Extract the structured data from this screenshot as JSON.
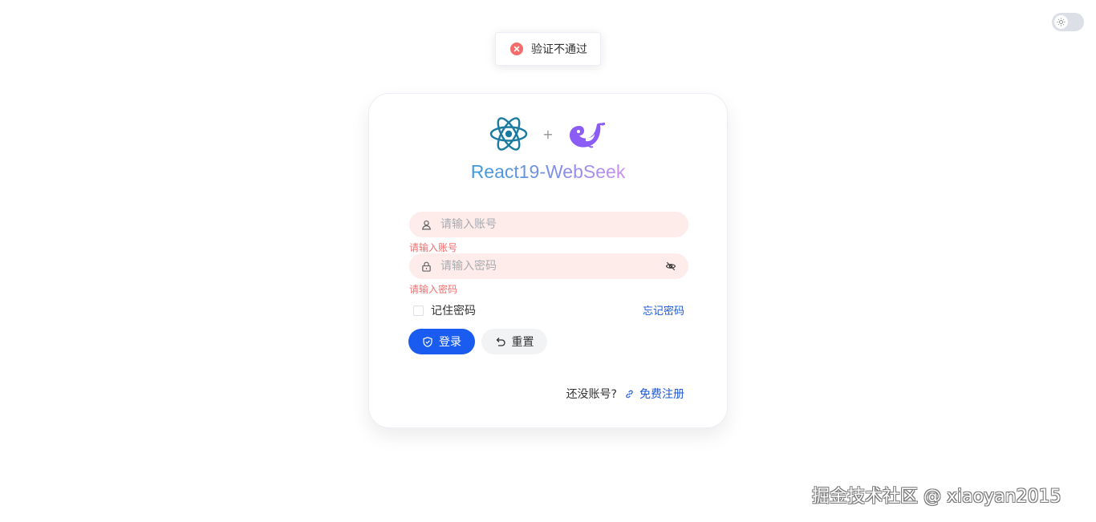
{
  "toast": {
    "message": "验证不通过",
    "icon": "error-circle-icon",
    "color": "#f56c6c"
  },
  "theme_toggle": {
    "icon": "sun-icon"
  },
  "header": {
    "plus": "+",
    "title": "React19-WebSeek",
    "logos": [
      "react-logo-icon",
      "deepseek-whale-icon"
    ]
  },
  "form": {
    "username": {
      "placeholder": "请输入账号",
      "value": "",
      "error": "请输入账号",
      "icon": "user-icon"
    },
    "password": {
      "placeholder": "请输入密码",
      "value": "",
      "error": "请输入密码",
      "icon": "lock-icon",
      "toggle_icon": "eye-off-icon"
    },
    "remember_label": "记住密码",
    "forgot_label": "忘记密码",
    "login_label": "登录",
    "reset_label": "重置",
    "register_prompt": "还没账号?",
    "register_label": "免费注册"
  },
  "colors": {
    "primary": "#1b5cf0",
    "link": "#1e59d9",
    "error": "#f56c6c",
    "field_bg": "#fdece9"
  },
  "watermark": "掘金技术社区 @ xiaoyan2015"
}
